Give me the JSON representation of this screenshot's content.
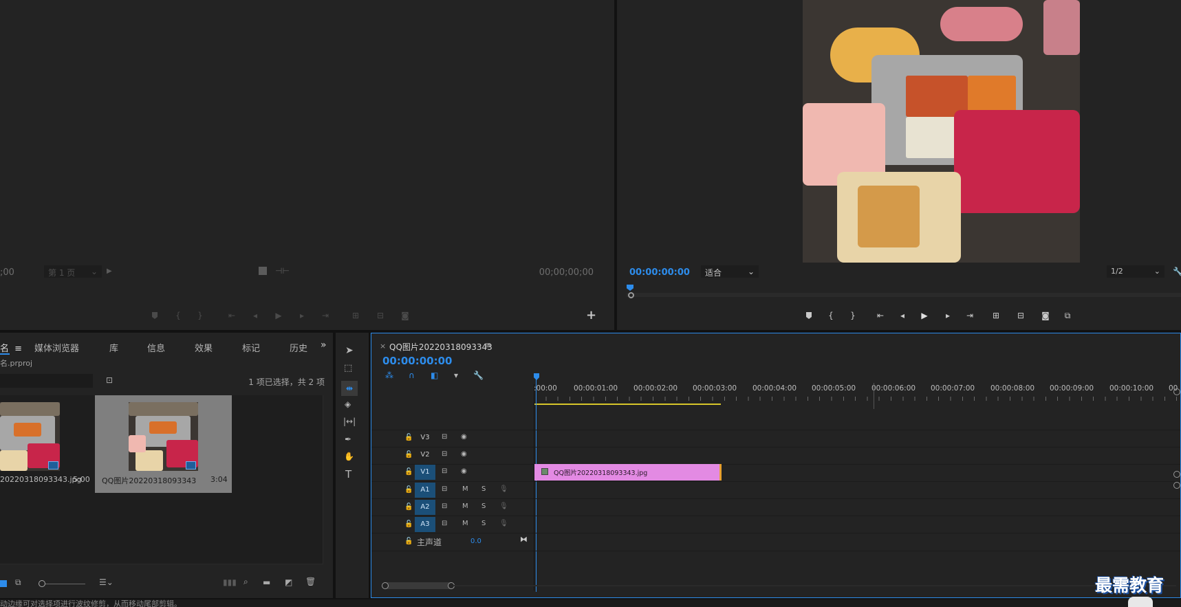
{
  "source_monitor": {
    "timecode_left": ";00",
    "page_select": "第 1 页",
    "timecode_right": "00;00;00;00"
  },
  "program_monitor": {
    "timecode": "00:00:00:00",
    "fit_select": "适合",
    "resolution_select": "1/2"
  },
  "project_panel": {
    "tabs": [
      "名",
      "媒体浏览器",
      "库",
      "信息",
      "效果",
      "标记",
      "历史"
    ],
    "project_file": "名.prproj",
    "selection_info": "1 项已选择，共 2 项",
    "items": [
      {
        "name": "20220318093343.jpg",
        "duration": "5:00"
      },
      {
        "name": "QQ图片20220318093343",
        "duration": "3:04"
      }
    ]
  },
  "timeline": {
    "sequence_name": "QQ图片20220318093343",
    "timecode": "00:00:00:00",
    "ruler": [
      ":00:00",
      "00:00:01:00",
      "00:00:02:00",
      "00:00:03:00",
      "00:00:04:00",
      "00:00:05:00",
      "00:00:06:00",
      "00:00:07:00",
      "00:00:08:00",
      "00:00:09:00",
      "00:00:10:00",
      "00"
    ],
    "video_tracks": [
      "V3",
      "V2",
      "V1"
    ],
    "audio_tracks": [
      "A1",
      "A2",
      "A3"
    ],
    "mute_label": "M",
    "solo_label": "S",
    "master_label": "主声道",
    "master_value": "0.0",
    "clip_name": "QQ图片20220318093343.jpg"
  },
  "status_bar": {
    "text": "动边缘可对选择项进行波纹修剪，从而移动尾部剪辑。"
  },
  "watermark": {
    "text": "最需教育"
  },
  "colors": {
    "accent_blue": "#2d8ceb",
    "clip_pink": "#e38ae3",
    "work_area_yellow": "#d8c72a"
  }
}
